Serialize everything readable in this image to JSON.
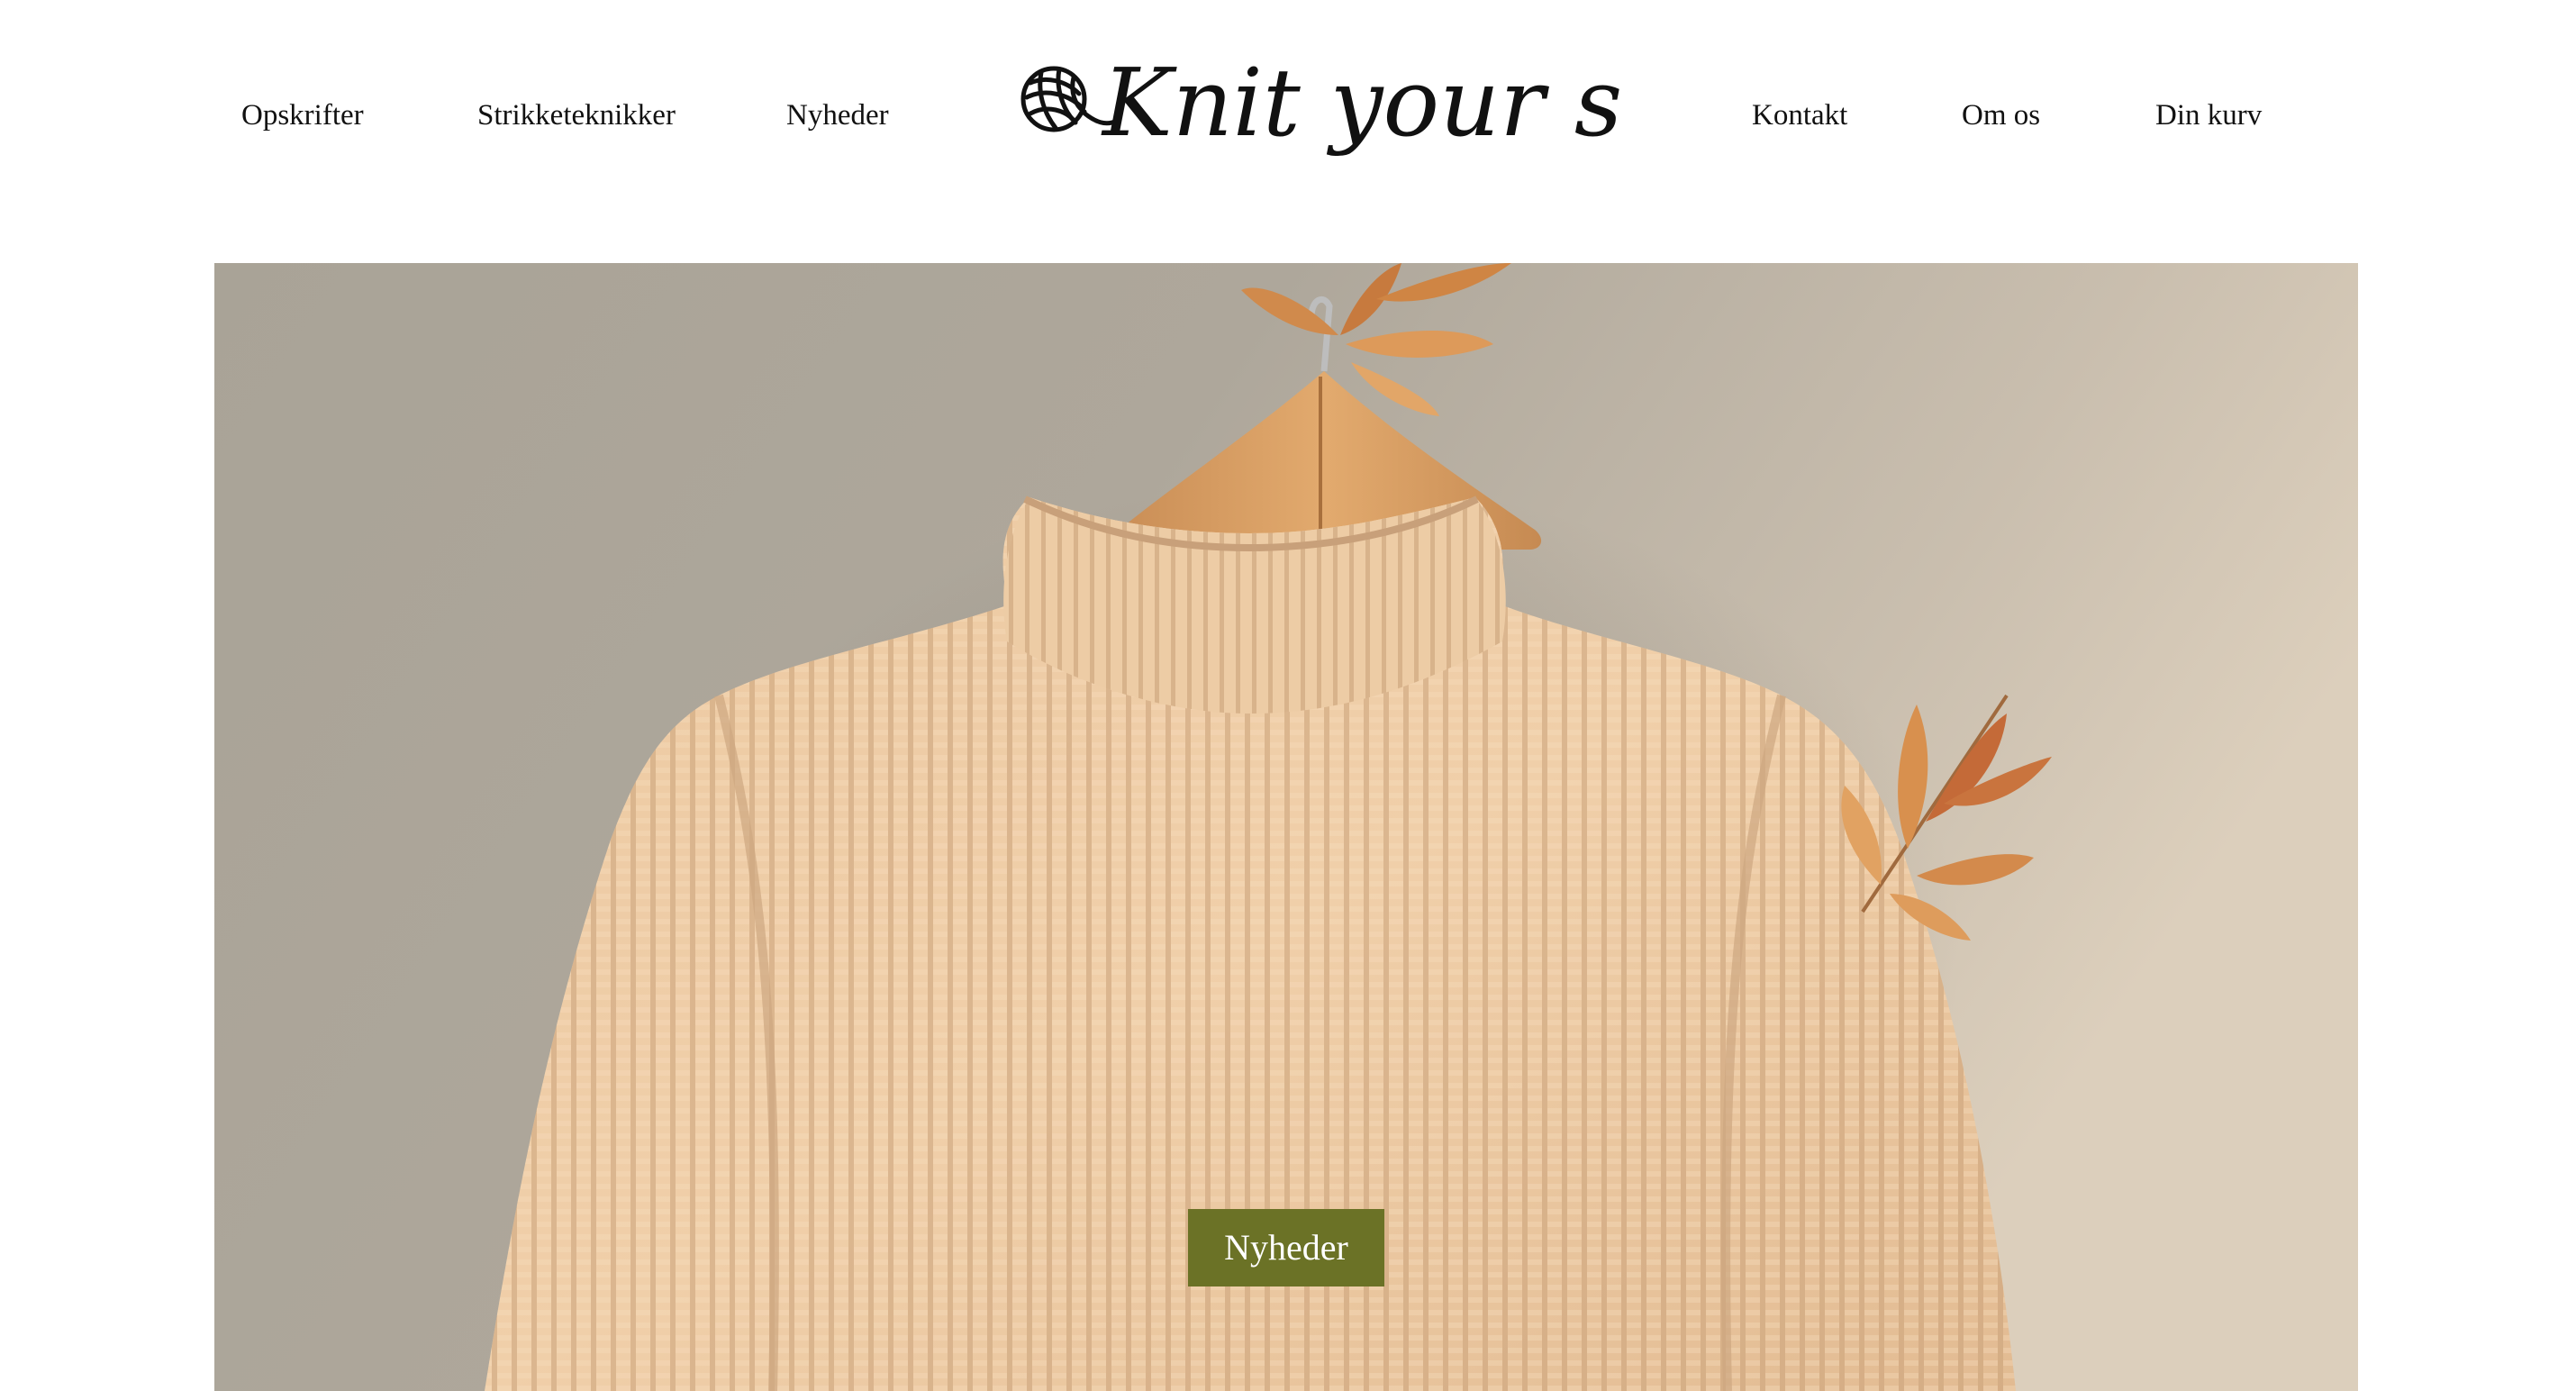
{
  "nav": {
    "left": [
      {
        "label": "Opskrifter"
      },
      {
        "label": "Strikketeknikker"
      },
      {
        "label": "Nyheder"
      }
    ],
    "right": [
      {
        "label": "Kontakt"
      },
      {
        "label": "Om os"
      },
      {
        "label": "Din kurv"
      }
    ]
  },
  "logo": {
    "text": "Knit your style",
    "icon": "yarn-ball-icon"
  },
  "hero": {
    "image": "knit-sweater-on-hanger-photo",
    "cta_label": "Nyheder"
  },
  "colors": {
    "background": "#ffffff",
    "text": "#111111",
    "cta_background": "#6b7226",
    "cta_text": "#ffffff"
  }
}
